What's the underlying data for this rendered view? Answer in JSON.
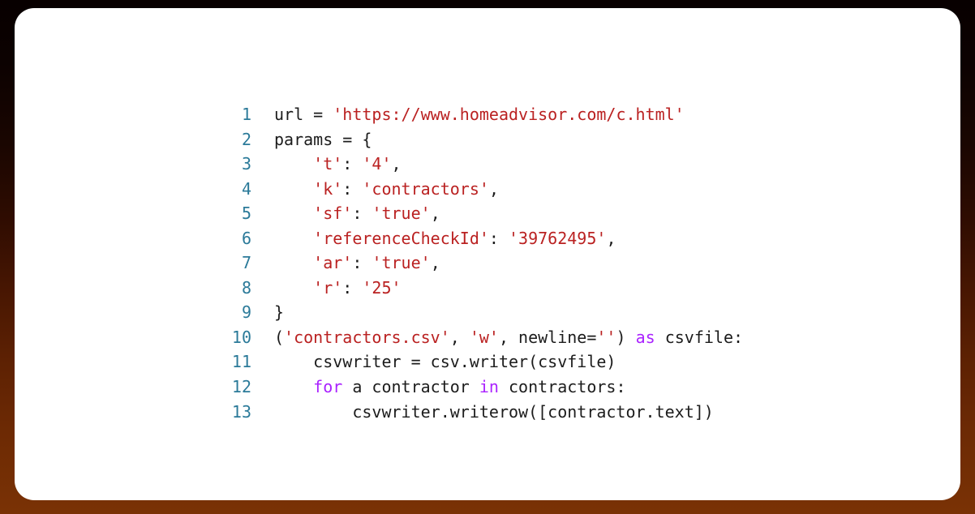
{
  "frame": {
    "background_gradient_top": "#080000",
    "background_gradient_bottom": "#7a3205",
    "card_background": "#ffffff"
  },
  "theme": {
    "linenumber_color": "#2b7a99",
    "plain_color": "#1c1c1c",
    "string_color": "#ba2121",
    "keyword_color": "#aa22ff",
    "font_size_px": "20"
  },
  "code": {
    "language": "python",
    "line_count": "13",
    "lines": [
      {
        "num": "1",
        "text": "url = 'https://www.homeadvisor.com/c.html'"
      },
      {
        "num": "2",
        "text": "params = {"
      },
      {
        "num": "3",
        "text": "    't': '4',"
      },
      {
        "num": "4",
        "text": "    'k': 'contractors',"
      },
      {
        "num": "5",
        "text": "    'sf': 'true',"
      },
      {
        "num": "6",
        "text": "    'referenceCheckId': '39762495',"
      },
      {
        "num": "7",
        "text": "    'ar': 'true',"
      },
      {
        "num": "8",
        "text": "    'r': '25'"
      },
      {
        "num": "9",
        "text": "}"
      },
      {
        "num": "10",
        "text": "('contractors.csv', 'w', newline='') as csvfile:"
      },
      {
        "num": "11",
        "text": "    csvwriter = csv.writer(csvfile)"
      },
      {
        "num": "12",
        "text": "    for a contractor in contractors:"
      },
      {
        "num": "13",
        "text": "        csvwriter.writerow([contractor.text])"
      }
    ],
    "tokens": [
      [
        {
          "t": "url = ",
          "c": "plain"
        },
        {
          "t": "'https://www.homeadvisor.com/c.html'",
          "c": "string"
        }
      ],
      [
        {
          "t": "params = {",
          "c": "plain"
        }
      ],
      [
        {
          "t": "    ",
          "c": "plain"
        },
        {
          "t": "'t'",
          "c": "string"
        },
        {
          "t": ": ",
          "c": "plain"
        },
        {
          "t": "'4'",
          "c": "string"
        },
        {
          "t": ",",
          "c": "plain"
        }
      ],
      [
        {
          "t": "    ",
          "c": "plain"
        },
        {
          "t": "'k'",
          "c": "string"
        },
        {
          "t": ": ",
          "c": "plain"
        },
        {
          "t": "'contractors'",
          "c": "string"
        },
        {
          "t": ",",
          "c": "plain"
        }
      ],
      [
        {
          "t": "    ",
          "c": "plain"
        },
        {
          "t": "'sf'",
          "c": "string"
        },
        {
          "t": ": ",
          "c": "plain"
        },
        {
          "t": "'true'",
          "c": "string"
        },
        {
          "t": ",",
          "c": "plain"
        }
      ],
      [
        {
          "t": "    ",
          "c": "plain"
        },
        {
          "t": "'referenceCheckId'",
          "c": "string"
        },
        {
          "t": ": ",
          "c": "plain"
        },
        {
          "t": "'39762495'",
          "c": "string"
        },
        {
          "t": ",",
          "c": "plain"
        }
      ],
      [
        {
          "t": "    ",
          "c": "plain"
        },
        {
          "t": "'ar'",
          "c": "string"
        },
        {
          "t": ": ",
          "c": "plain"
        },
        {
          "t": "'true'",
          "c": "string"
        },
        {
          "t": ",",
          "c": "plain"
        }
      ],
      [
        {
          "t": "    ",
          "c": "plain"
        },
        {
          "t": "'r'",
          "c": "string"
        },
        {
          "t": ": ",
          "c": "plain"
        },
        {
          "t": "'25'",
          "c": "string"
        }
      ],
      [
        {
          "t": "}",
          "c": "plain"
        }
      ],
      [
        {
          "t": "(",
          "c": "plain"
        },
        {
          "t": "'contractors.csv'",
          "c": "string"
        },
        {
          "t": ", ",
          "c": "plain"
        },
        {
          "t": "'w'",
          "c": "string"
        },
        {
          "t": ", newline=",
          "c": "plain"
        },
        {
          "t": "''",
          "c": "string"
        },
        {
          "t": ") ",
          "c": "plain"
        },
        {
          "t": "as",
          "c": "keyword"
        },
        {
          "t": " csvfile:",
          "c": "plain"
        }
      ],
      [
        {
          "t": "    csvwriter = csv.writer(csvfile)",
          "c": "plain"
        }
      ],
      [
        {
          "t": "    ",
          "c": "plain"
        },
        {
          "t": "for",
          "c": "keyword"
        },
        {
          "t": " a contractor ",
          "c": "plain"
        },
        {
          "t": "in",
          "c": "keyword"
        },
        {
          "t": " contractors:",
          "c": "plain"
        }
      ],
      [
        {
          "t": "        csvwriter.writerow([contractor.text])",
          "c": "plain"
        }
      ]
    ]
  }
}
